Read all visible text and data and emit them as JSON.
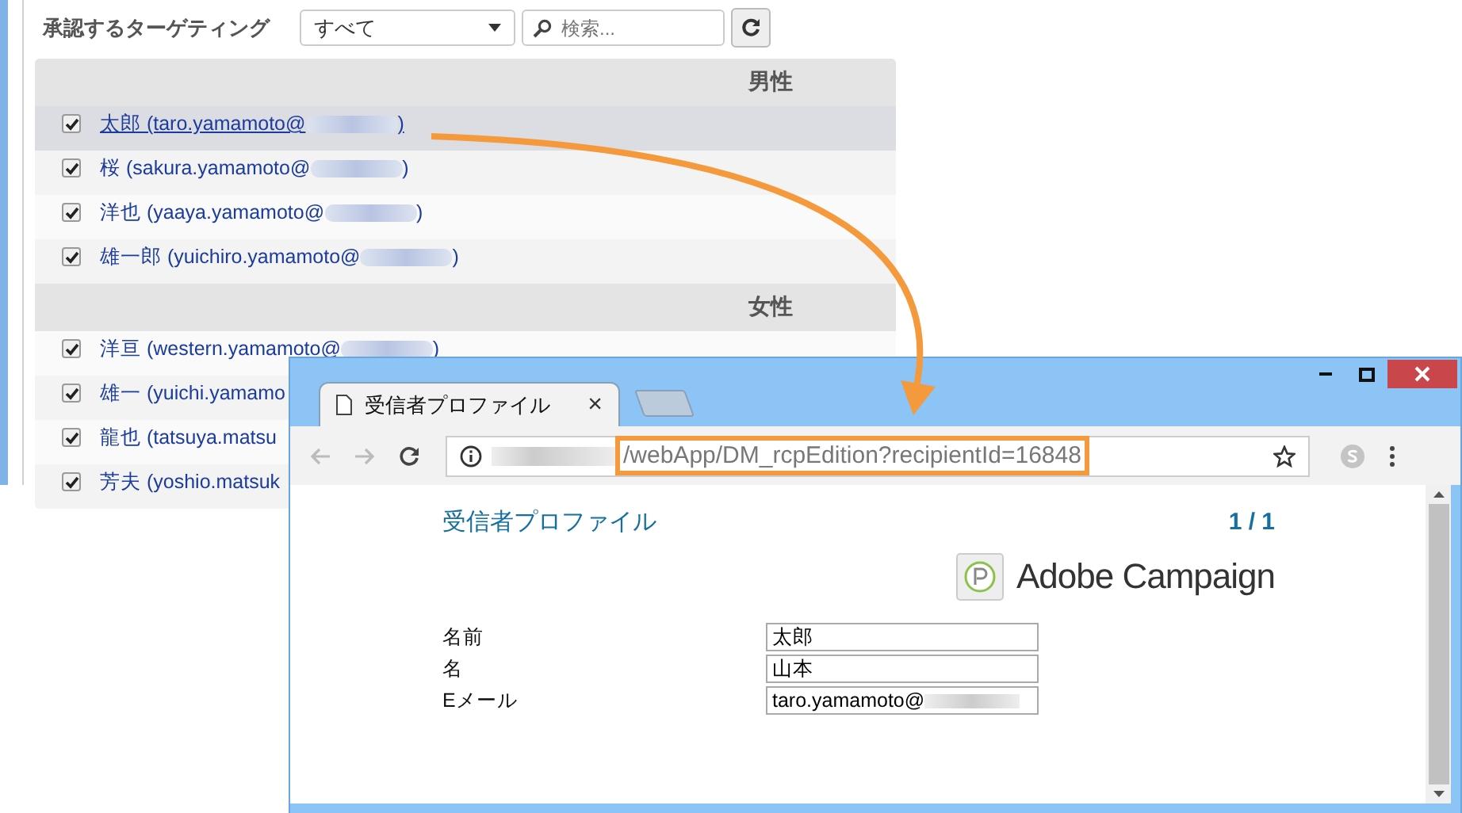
{
  "targeting": {
    "label": "承認するターゲティング",
    "filter": "すべて",
    "search_placeholder": "検索..."
  },
  "groups": [
    {
      "title": "男性",
      "rows": [
        {
          "text": "太郎 (taro.yamamoto@",
          "suffix": ")",
          "checked": true,
          "selected": true
        },
        {
          "text": "桜 (sakura.yamamoto@",
          "suffix": ")",
          "checked": true,
          "selected": false
        },
        {
          "text": "洋也 (yaaya.yamamoto@",
          "suffix": ")",
          "checked": true,
          "selected": false
        },
        {
          "text": "雄一郎 (yuichiro.yamamoto@",
          "suffix": ")",
          "checked": true,
          "selected": false
        }
      ]
    },
    {
      "title": "女性",
      "rows": [
        {
          "text": "洋亘 (western.yamamoto@",
          "suffix": ")",
          "checked": true,
          "selected": false
        },
        {
          "text": "雄一 (yuichi.yamamo",
          "checked": true,
          "selected": false
        },
        {
          "text": "龍也 (tatsuya.matsu",
          "checked": true,
          "selected": false
        },
        {
          "text": "芳夫 (yoshio.matsuk",
          "checked": true,
          "selected": false
        }
      ]
    }
  ],
  "browser": {
    "tab_title": "受信者プロファイル",
    "tab_close": "×",
    "url": "/webApp/DM_rcpEdition?recipientId=16848",
    "page": {
      "title": "受信者プロファイル",
      "pager": "1 / 1",
      "brand": "Adobe Campaign",
      "fields": [
        {
          "label": "名前",
          "value": "太郎"
        },
        {
          "label": "名",
          "value": "山本"
        },
        {
          "label": "Eメール",
          "value": "taro.yamamoto@",
          "redacted": true
        }
      ]
    }
  }
}
